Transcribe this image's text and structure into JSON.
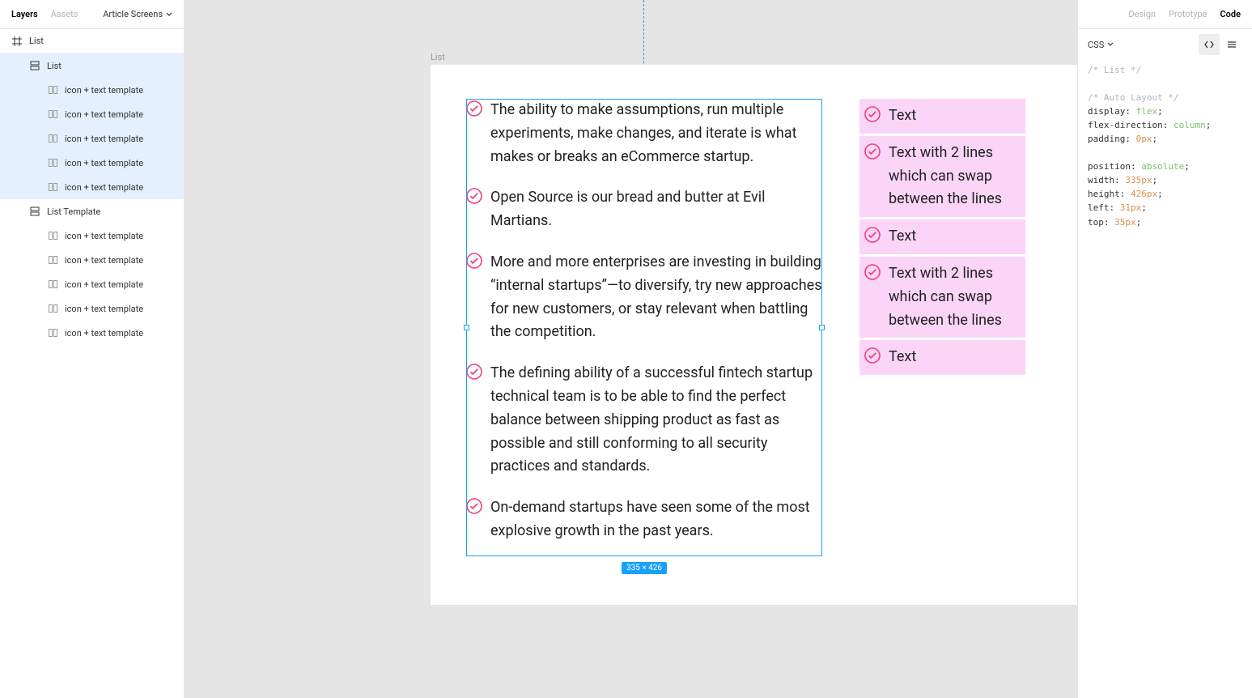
{
  "leftPanel": {
    "tabs": {
      "layers": "Layers",
      "assets": "Assets"
    },
    "pageDropdown": "Article Screens",
    "rootFrame": "List",
    "layers": [
      {
        "label": "List",
        "type": "list",
        "depth": 1,
        "selected": true
      },
      {
        "label": "icon + text template",
        "type": "comp",
        "depth": 2,
        "selected": true
      },
      {
        "label": "icon + text template",
        "type": "comp",
        "depth": 2,
        "selected": true
      },
      {
        "label": "icon + text template",
        "type": "comp",
        "depth": 2,
        "selected": true
      },
      {
        "label": "icon + text template",
        "type": "comp",
        "depth": 2,
        "selected": true
      },
      {
        "label": "icon + text template",
        "type": "comp",
        "depth": 2,
        "selected": true
      },
      {
        "label": "List Template",
        "type": "list",
        "depth": 1,
        "selected": false
      },
      {
        "label": "icon + text template",
        "type": "comp",
        "depth": 2,
        "selected": false
      },
      {
        "label": "icon + text template",
        "type": "comp",
        "depth": 2,
        "selected": false
      },
      {
        "label": "icon + text template",
        "type": "comp",
        "depth": 2,
        "selected": false
      },
      {
        "label": "icon + text template",
        "type": "comp",
        "depth": 2,
        "selected": false
      },
      {
        "label": "icon + text template",
        "type": "comp",
        "depth": 2,
        "selected": false
      }
    ]
  },
  "canvas": {
    "frameLabel": "List",
    "selectionBadge": "335 × 426",
    "listA": [
      "The ability to make assumptions, run multiple experiments, make changes, and iterate is what makes or breaks an eCommerce startup.",
      "Open Source is our bread and butter at Evil Martians.",
      "More and more enterprises are investing in building “internal startups”—to diversify, try new approaches for new customers, or stay relevant when battling the competition.",
      "The defining ability of a successful fintech startup technical team is to be able to find the perfect balance between shipping product as fast as possible and still conforming to all security practices and standards.",
      "On-demand startups have seen some of the most explosive growth in the past years."
    ],
    "listB": [
      "Text",
      "Text with 2 lines which can swap between the lines",
      "Text",
      "Text with 2 lines which can swap between the lines",
      "Text"
    ]
  },
  "rightPanel": {
    "tabs": {
      "design": "Design",
      "prototype": "Prototype",
      "code": "Code"
    },
    "langDropdown": "CSS",
    "code": {
      "comment1": "/* List */",
      "comment2": "/* Auto Layout */",
      "lines": [
        {
          "prop": "display",
          "val": "flex",
          "kw": true
        },
        {
          "prop": "flex-direction",
          "val": "column",
          "kw": true
        },
        {
          "prop": "padding",
          "val": "0px",
          "kw": false
        }
      ],
      "lines2": [
        {
          "prop": "position",
          "val": "absolute",
          "kw": true
        },
        {
          "prop": "width",
          "val": "335px",
          "kw": false
        },
        {
          "prop": "height",
          "val": "426px",
          "kw": false
        },
        {
          "prop": "left",
          "val": "31px",
          "kw": false
        },
        {
          "prop": "top",
          "val": "35px",
          "kw": false
        }
      ]
    }
  }
}
